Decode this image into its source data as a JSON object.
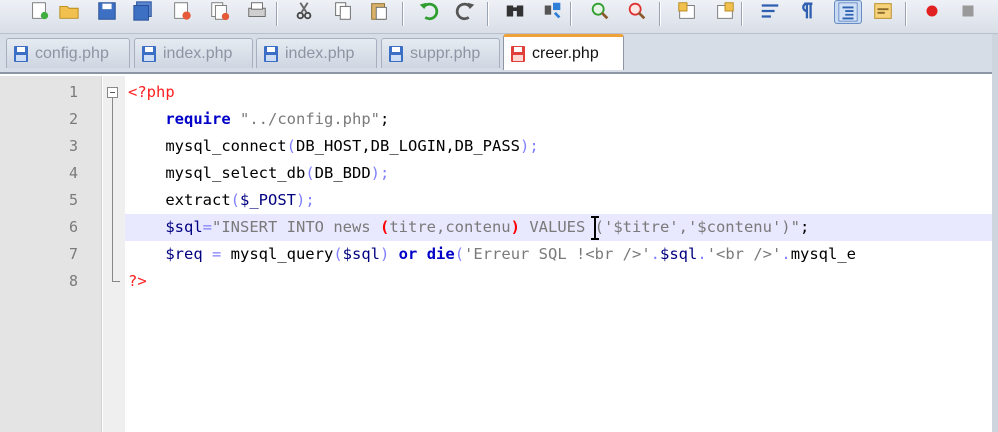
{
  "colors": {
    "toolbar_bg": "#dfe4ec",
    "active_tab_accent": "#f0a23a",
    "current_line": "#e8e8ff",
    "php_tag": "#ff2020",
    "keyword": "#0000c8",
    "string": "#7a7a7a"
  },
  "toolbar": {
    "buttons": [
      "new-file-icon",
      "open-folder-icon",
      "save-icon",
      "save-all-icon",
      "close-icon",
      "close-all-icon",
      "print-icon",
      "cut-icon",
      "copy-icon",
      "paste-icon",
      "undo-icon",
      "redo-icon",
      "find-icon",
      "replace-icon",
      "zoom-in-icon",
      "zoom-out-icon",
      "sync-v-icon",
      "sync-h-icon",
      "wrap-icon",
      "show-symbols-icon",
      "indent-guide-icon",
      "user-lang-icon",
      "record-macro-icon",
      "stop-macro-icon"
    ]
  },
  "tabs": [
    {
      "label": "config.php",
      "active": false
    },
    {
      "label": "index.php",
      "active": false
    },
    {
      "label": "index.php",
      "active": false
    },
    {
      "label": "suppr.php",
      "active": false
    },
    {
      "label": "creer.php",
      "active": true
    }
  ],
  "editor": {
    "line_numbers": [
      "1",
      "2",
      "3",
      "4",
      "5",
      "6",
      "7",
      "8"
    ],
    "current_line": 6,
    "lines": [
      [
        {
          "t": "<?php",
          "c": "php"
        }
      ],
      [
        {
          "t": "    ",
          "c": "punc"
        },
        {
          "t": "require",
          "c": "kw"
        },
        {
          "t": " ",
          "c": "punc"
        },
        {
          "t": "\"../config.php\"",
          "c": "str"
        },
        {
          "t": ";",
          "c": "punc"
        }
      ],
      [
        {
          "t": "    ",
          "c": "punc"
        },
        {
          "t": "mysql_connect",
          "c": "fn"
        },
        {
          "t": "(",
          "c": "op"
        },
        {
          "t": "DB_HOST",
          "c": "fn"
        },
        {
          "t": ",",
          "c": "punc"
        },
        {
          "t": "DB_LOGIN",
          "c": "fn"
        },
        {
          "t": ",",
          "c": "punc"
        },
        {
          "t": "DB_PASS",
          "c": "fn"
        },
        {
          "t": ");",
          "c": "op"
        }
      ],
      [
        {
          "t": "    ",
          "c": "punc"
        },
        {
          "t": "mysql_select_db",
          "c": "fn"
        },
        {
          "t": "(",
          "c": "op"
        },
        {
          "t": "DB_BDD",
          "c": "fn"
        },
        {
          "t": ");",
          "c": "op"
        }
      ],
      [
        {
          "t": "    ",
          "c": "punc"
        },
        {
          "t": "extract",
          "c": "fn"
        },
        {
          "t": "(",
          "c": "op"
        },
        {
          "t": "$_POST",
          "c": "var"
        },
        {
          "t": ");",
          "c": "op"
        }
      ],
      [
        {
          "t": "    ",
          "c": "punc"
        },
        {
          "t": "$sql",
          "c": "var"
        },
        {
          "t": "=",
          "c": "op"
        },
        {
          "t": "\"INSERT INTO news ",
          "c": "str"
        },
        {
          "t": "(",
          "c": "brace"
        },
        {
          "t": "titre,contenu",
          "c": "str"
        },
        {
          "t": ")",
          "c": "brace"
        },
        {
          "t": " VALUES ('$titre','$contenu')\"",
          "c": "str"
        },
        {
          "t": ";",
          "c": "punc"
        }
      ],
      [
        {
          "t": "    ",
          "c": "punc"
        },
        {
          "t": "$req",
          "c": "var"
        },
        {
          "t": " = ",
          "c": "op"
        },
        {
          "t": "mysql_query",
          "c": "fn"
        },
        {
          "t": "(",
          "c": "op"
        },
        {
          "t": "$sql",
          "c": "var"
        },
        {
          "t": ")",
          "c": "op"
        },
        {
          "t": " ",
          "c": "punc"
        },
        {
          "t": "or",
          "c": "kw"
        },
        {
          "t": " ",
          "c": "punc"
        },
        {
          "t": "die",
          "c": "kw"
        },
        {
          "t": "(",
          "c": "op"
        },
        {
          "t": "'Erreur SQL !<br />'",
          "c": "str"
        },
        {
          "t": ".",
          "c": "op"
        },
        {
          "t": "$sql",
          "c": "var"
        },
        {
          "t": ".",
          "c": "op"
        },
        {
          "t": "'<br />'",
          "c": "str"
        },
        {
          "t": ".",
          "c": "op"
        },
        {
          "t": "mysql_e",
          "c": "fn"
        }
      ],
      [
        {
          "t": "?>",
          "c": "php"
        }
      ]
    ]
  }
}
